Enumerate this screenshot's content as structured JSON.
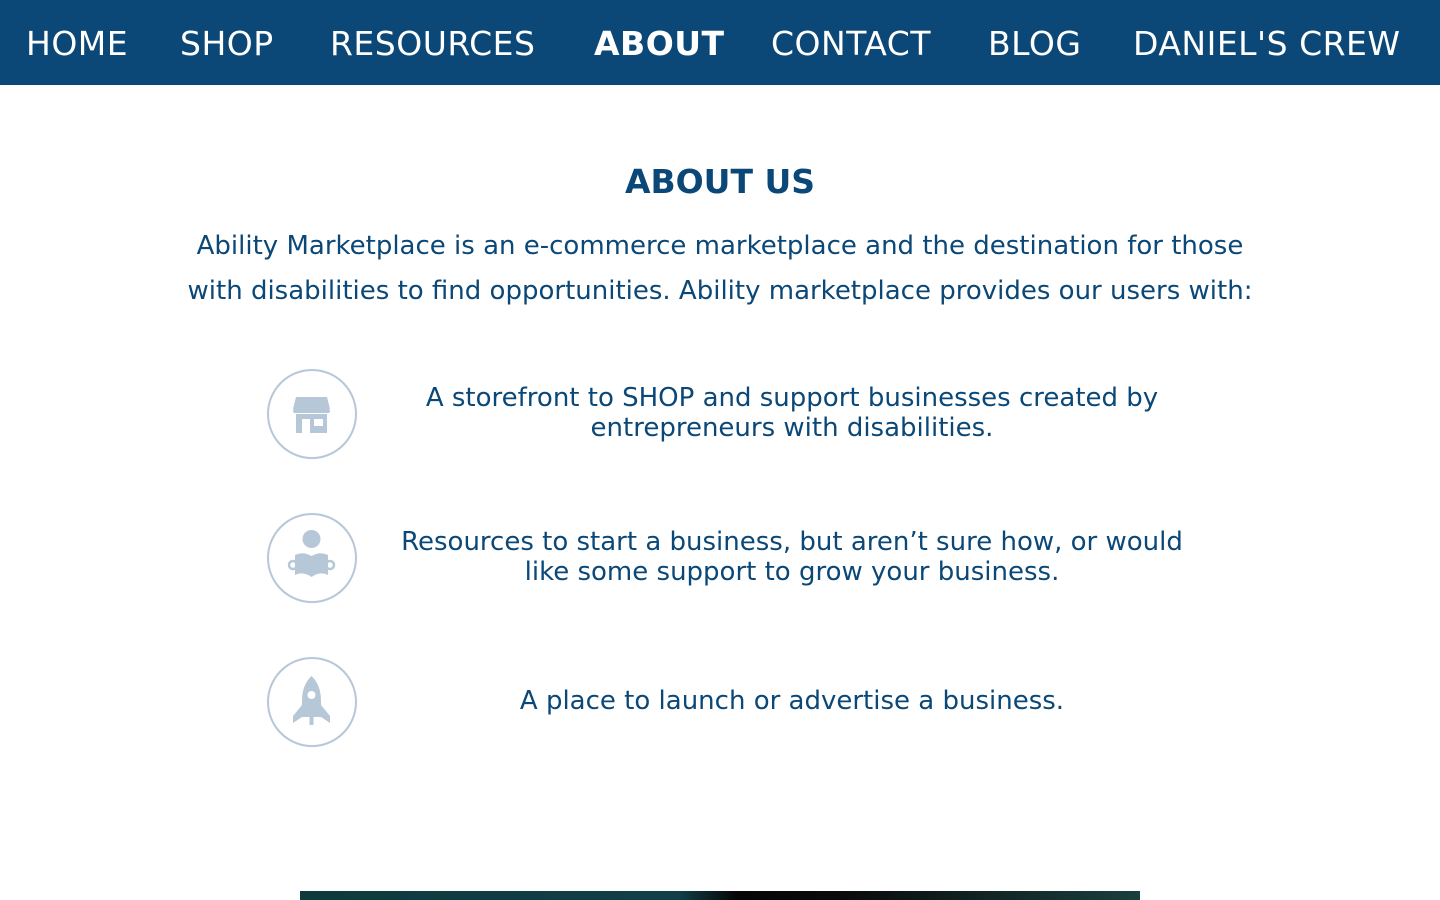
{
  "nav": {
    "items": [
      {
        "label": "HOME"
      },
      {
        "label": "SHOP"
      },
      {
        "label": "RESOURCES"
      },
      {
        "label": "ABOUT"
      },
      {
        "label": "CONTACT"
      },
      {
        "label": "BLOG"
      },
      {
        "label": "DANIEL'S CREW"
      }
    ],
    "active": "ABOUT"
  },
  "about": {
    "title": "ABOUT US",
    "intro_line1": "Ability Marketplace is an e-commerce marketplace and the destination for those",
    "intro_line2": "with disabilities to find opportunities. Ability marketplace provides our users with:",
    "features": [
      {
        "icon": "storefront-icon",
        "line1": "A storefront to SHOP and support businesses created by",
        "line2": "entrepreneurs with disabilities."
      },
      {
        "icon": "person-reading-icon",
        "line1": "Resources to start a business, but aren’t sure how, or would",
        "line2": "like some support to grow your business."
      },
      {
        "icon": "rocket-icon",
        "line1": "A place to launch or advertise a business."
      }
    ]
  },
  "colors": {
    "brand_blue": "#0b4877",
    "icon_gray_blue": "#b6c7d7",
    "nav_text": "#ffffff"
  }
}
